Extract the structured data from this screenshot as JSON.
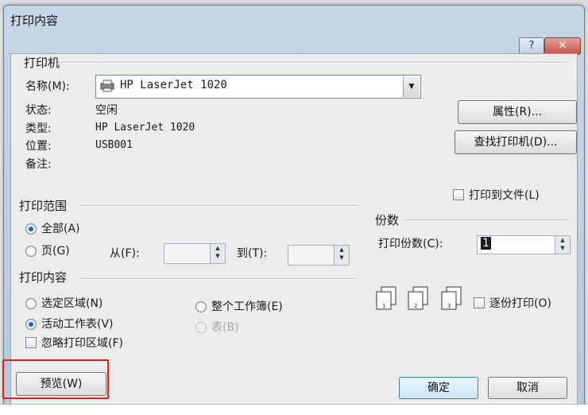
{
  "dialog": {
    "title": "打印内容",
    "help_icon": "question-icon",
    "close_icon": "close-icon"
  },
  "printer": {
    "group_label": "打印机",
    "name_label": "名称(M):",
    "name_value": "HP LaserJet 1020",
    "status_label": "状态:",
    "status_value": "空闲",
    "type_label": "类型:",
    "type_value": "HP LaserJet 1020",
    "location_label": "位置:",
    "location_value": "USB001",
    "comment_label": "备注:",
    "properties_button": "属性(R)...",
    "find_printer_button": "查找打印机(D)...",
    "print_to_file_label": "打印到文件(L)"
  },
  "print_range": {
    "group_label": "打印范围",
    "all_label": "全部(A)",
    "pages_label": "页(G)",
    "from_label": "从(F):",
    "to_label": "到(T):",
    "from_value": "",
    "to_value": ""
  },
  "copies": {
    "group_label": "份数",
    "count_label": "打印份数(C):",
    "count_value": "1",
    "collate_label": "逐份打印(O)"
  },
  "print_what": {
    "group_label": "打印内容",
    "selection_label": "选定区域(N)",
    "active_sheets_label": "活动工作表(V)",
    "entire_workbook_label": "整个工作簿(E)",
    "table_label": "表(B)",
    "ignore_print_areas_label": "忽略打印区域(F)"
  },
  "footer": {
    "preview_button": "预览(W)",
    "ok_button": "确定",
    "cancel_button": "取消"
  },
  "accent_color": "#1f63c4",
  "highlight_color": "#e21e1e"
}
